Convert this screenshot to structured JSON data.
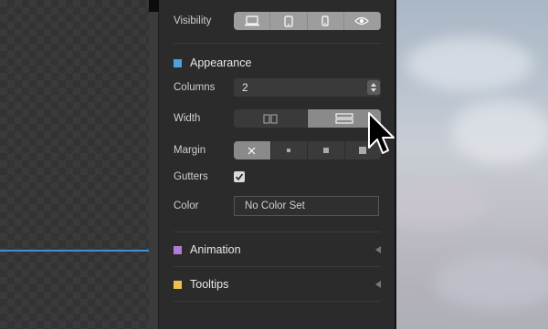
{
  "inspector": {
    "visibility": {
      "label": "Visibility",
      "options": [
        "desktop-icon",
        "tablet-icon",
        "phone-icon",
        "eye-icon"
      ]
    },
    "appearance": {
      "title": "Appearance",
      "color": {
        "label": "Color",
        "value": "No Color Set"
      },
      "columns": {
        "label": "Columns",
        "value": "2"
      },
      "width": {
        "label": "Width",
        "options": [
          "two-column-icon",
          "stacked-rows-icon"
        ],
        "selected": 1
      },
      "margin": {
        "label": "Margin",
        "options": [
          "none-icon",
          "small-square-icon",
          "medium-square-icon",
          "large-square-icon"
        ],
        "selected": 0
      },
      "gutters": {
        "label": "Gutters",
        "checked": true
      }
    },
    "animation": {
      "title": "Animation",
      "color": "#b07cd8"
    },
    "tooltips": {
      "title": "Tooltips",
      "color": "#efc14a"
    }
  }
}
